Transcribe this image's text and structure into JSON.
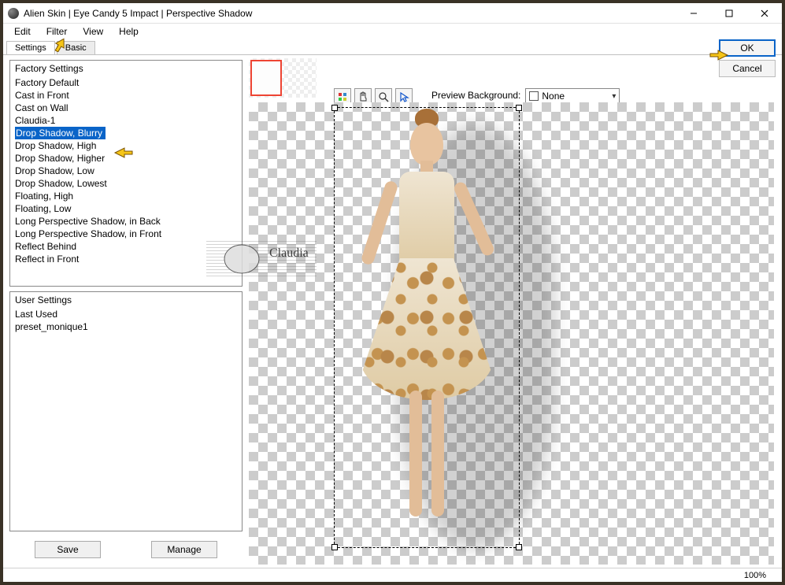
{
  "title": "Alien Skin | Eye Candy 5 Impact | Perspective Shadow",
  "menu": {
    "edit": "Edit",
    "filter": "Filter",
    "view": "View",
    "help": "Help"
  },
  "tabs": {
    "settings": "Settings",
    "basic": "Basic"
  },
  "factory": {
    "header": "Factory Settings",
    "items": [
      "Factory Default",
      "Cast in Front",
      "Cast on Wall",
      "Claudia-1",
      "Drop Shadow, Blurry",
      "Drop Shadow, High",
      "Drop Shadow, Higher",
      "Drop Shadow, Low",
      "Drop Shadow, Lowest",
      "Floating, High",
      "Floating, Low",
      "Long Perspective Shadow, in Back",
      "Long Perspective Shadow, in Front",
      "Reflect Behind",
      "Reflect in Front"
    ],
    "selected_index": 4
  },
  "user": {
    "header": "User Settings",
    "items": [
      "Last Used",
      "preset_monique1"
    ]
  },
  "buttons": {
    "save": "Save",
    "manage": "Manage",
    "ok": "OK",
    "cancel": "Cancel"
  },
  "preview": {
    "label": "Preview Background:",
    "value": "None"
  },
  "status": {
    "zoom": "100%"
  },
  "watermark": "Claudia"
}
